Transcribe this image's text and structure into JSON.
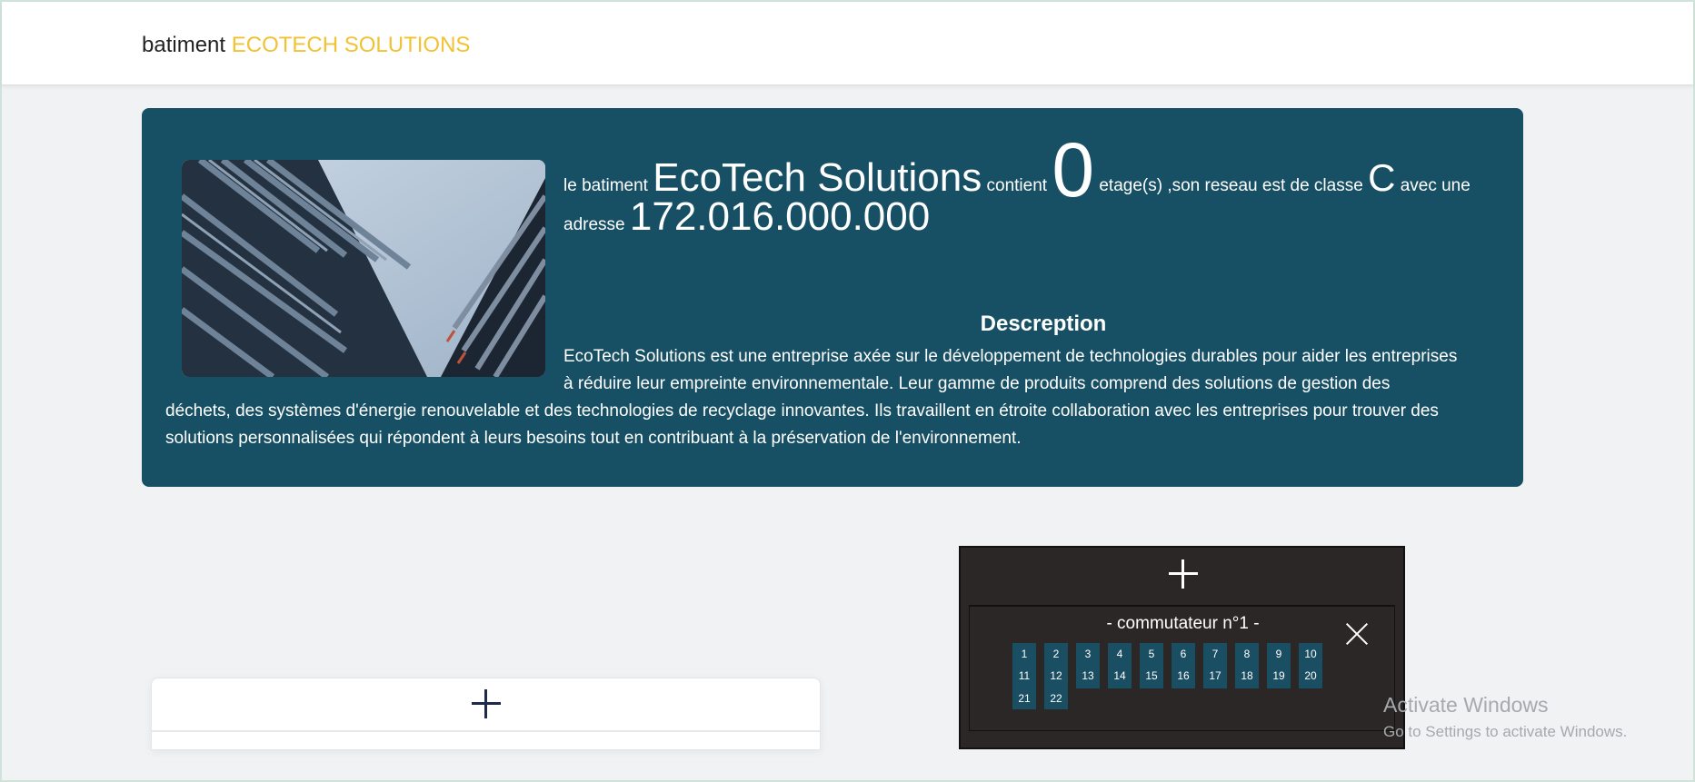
{
  "navbar": {
    "brand_prefix": "batiment",
    "brand_name": "ECOTECH SOLUTIONS"
  },
  "building": {
    "text_le": "le batiment",
    "name": "EcoTech Solutions",
    "text_contient": "contient",
    "floors": "0",
    "text_etage": "etage(s) ,son reseau est de classe",
    "network_class": "C",
    "text_avec": "avec une",
    "text_adresse": "adresse",
    "address": "172.016.000.000"
  },
  "description": {
    "title": "Descreption",
    "lines": [
      "EcoTech Solutions est une entreprise axée sur le développement de technologies durables pour aider les entreprises",
      "à réduire leur empreinte environnementale. Leur gamme de produits comprend des solutions de gestion des",
      "déchets, des systèmes d'énergie renouvelable et des technologies de recyclage innovantes. Ils travaillent en étroite collaboration avec les entreprises pour trouver des",
      "solutions personnalisées qui répondent à leurs besoins tout en contribuant à la préservation de l'environnement."
    ]
  },
  "switch": {
    "title": "- commutateur n°1 -",
    "ports": [
      "1",
      "2",
      "3",
      "4",
      "5",
      "6",
      "7",
      "8",
      "9",
      "10",
      "11",
      "12",
      "13",
      "14",
      "15",
      "16",
      "17",
      "18",
      "19",
      "20",
      "21",
      "22"
    ]
  },
  "watermark": {
    "line1": "Activate Windows",
    "line2": "Go to Settings to activate Windows."
  },
  "colors": {
    "accent": "#f1c232",
    "hero_bg": "#175064",
    "switch_panel_bg": "#2b2726",
    "port_bg": "#1a4e62"
  }
}
